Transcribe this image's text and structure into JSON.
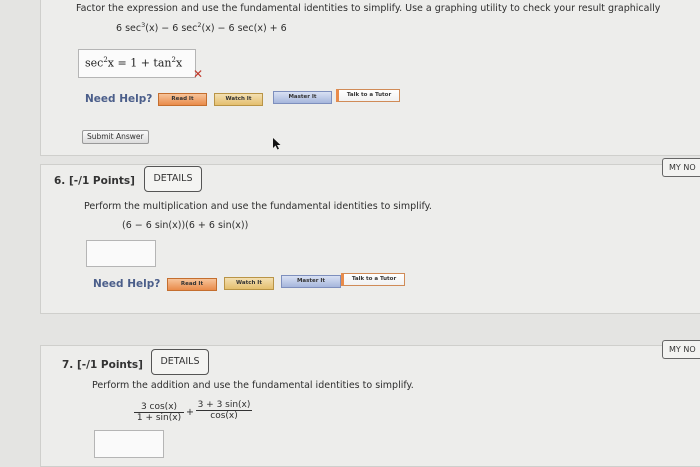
{
  "q5": {
    "instruction": "Factor the expression and use the fundamental identities to simplify. Use a graphing utility to check your result graphically",
    "expr_a": "6 sec",
    "expr_b": "(x) − 6 sec",
    "expr_c": "(x) − 6 sec(x) + 6",
    "sup3": "3",
    "sup2": "2",
    "answer_a": "sec",
    "answer_b": "x = 1 + tan",
    "answer_c": "x",
    "answer_sup": "2",
    "wrong_mark": "✕",
    "need_help": "Need Help?",
    "buttons": [
      "Read It",
      "Watch It",
      "Master It",
      "Talk to a Tutor"
    ],
    "submit_label": "Submit Answer"
  },
  "q6": {
    "title": "6.  [-/1 Points]",
    "details_label": "DETAILS",
    "my_notes": "MY NO",
    "instruction": "Perform the multiplication and use the fundamental identities to simplify.",
    "expression": "(6 − 6 sin(x))(6 + 6 sin(x))",
    "need_help": "Need Help?",
    "buttons": [
      "Read It",
      "Watch It",
      "Master It",
      "Talk to a Tutor"
    ]
  },
  "q7": {
    "title": "7.  [-/1 Points]",
    "details_label": "DETAILS",
    "my_notes": "MY NO",
    "instruction": "Perform the addition and use the fundamental identities to simplify.",
    "frac1_num": "3 cos(x)",
    "frac1_den": "1 + sin(x)",
    "plus": "+",
    "frac2_num": "3 + 3 sin(x)",
    "frac2_den": "cos(x)"
  },
  "colors": {
    "background": "#e4e4e2",
    "need_help": "#4b5e8a",
    "wrong": "#c0392b",
    "read_it": "#e98b4a",
    "watch_it": "#e4bf6e",
    "master_it": "#a6b6dc"
  }
}
